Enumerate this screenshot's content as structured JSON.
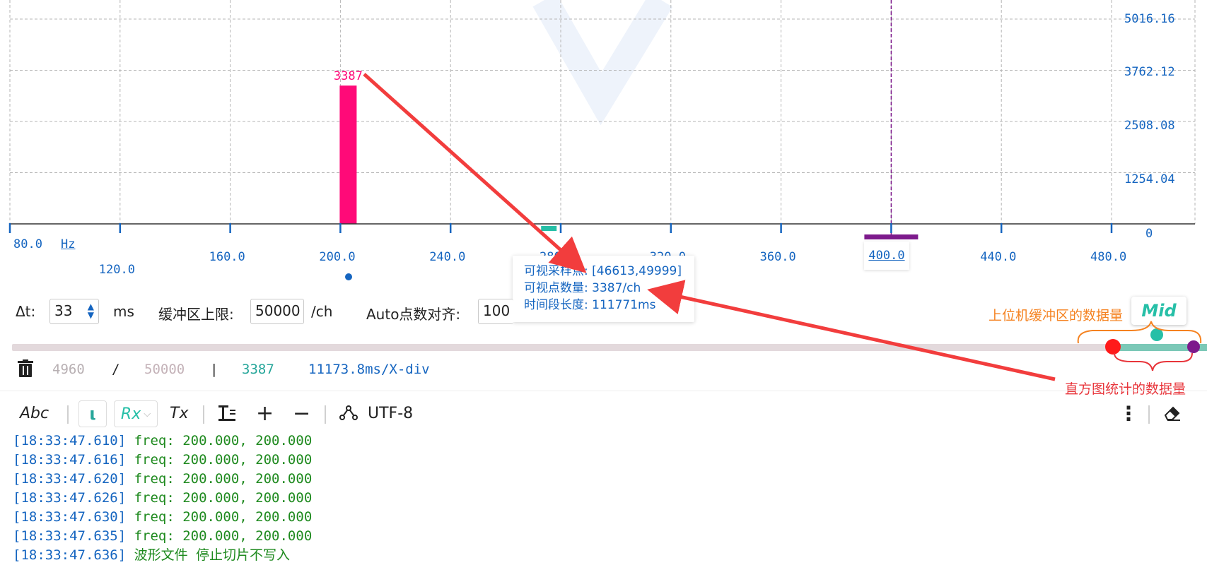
{
  "chart_data": {
    "type": "bar",
    "xlim": [
      80,
      500
    ],
    "ylim": [
      0,
      5500
    ],
    "x_ticks": [
      "80.0",
      "120.0",
      "160.0",
      "200.0",
      "240.0",
      "280.0",
      "320.0",
      "360.0",
      "400.0",
      "440.0",
      "480.0"
    ],
    "x_unit": "Hz",
    "y_ticks": [
      "5016.16",
      "3762.12",
      "2508.08",
      "1254.04",
      "0"
    ],
    "bars": [
      {
        "x": 200,
        "value": 3387,
        "label": "3387",
        "color": "#ff0a78"
      }
    ],
    "markers": [
      {
        "x": 278,
        "color": "#26bfa7",
        "kind": "range"
      },
      {
        "x": 400,
        "color": "#7d1a8c",
        "kind": "cursor"
      }
    ],
    "grid": true
  },
  "tooltip": {
    "line1": "可视采样点: [46613,49999]",
    "line2": "可视点数量: 3387/ch",
    "line3": "时间段长度: 111771ms"
  },
  "controls": {
    "dt_label": "Δt:",
    "dt_value": "33",
    "dt_unit": "ms",
    "buffer_label": "缓冲区上限:",
    "buffer_value": "50000",
    "buffer_unit": "/ch",
    "auto_label": "Auto点数对齐:",
    "auto_value": "100",
    "mid_label": "Mid",
    "slider_colors": {
      "track": "#e3d9dc",
      "fill": "#7bc8b7",
      "start": "#ff1a1a",
      "mid": "#26bfa7",
      "end": "#7d1a8c"
    }
  },
  "stats": {
    "current": "4960",
    "slash": "/",
    "total": "50000",
    "bar": "|",
    "count": "3387",
    "time_per_div": "11173.8ms/X-div"
  },
  "toolbar": {
    "abc": "Abc",
    "rx": "Rx",
    "tx": "Tx",
    "encoding": "UTF-8"
  },
  "annotations": {
    "buffer_note": "上位机缓冲区的数据量",
    "hist_note": "直方图统计的数据量"
  },
  "log": [
    {
      "ts": "[18:33:47.610]",
      "msg": " freq: 200.000, 200.000"
    },
    {
      "ts": "[18:33:47.616]",
      "msg": " freq: 200.000, 200.000"
    },
    {
      "ts": "[18:33:47.620]",
      "msg": " freq: 200.000, 200.000"
    },
    {
      "ts": "[18:33:47.626]",
      "msg": " freq: 200.000, 200.000"
    },
    {
      "ts": "[18:33:47.630]",
      "msg": " freq: 200.000, 200.000"
    },
    {
      "ts": "[18:33:47.635]",
      "msg": " freq: 200.000, 200.000"
    },
    {
      "ts": "[18:33:47.636]",
      "msg": " 波形文件 停止切片不写入"
    }
  ]
}
